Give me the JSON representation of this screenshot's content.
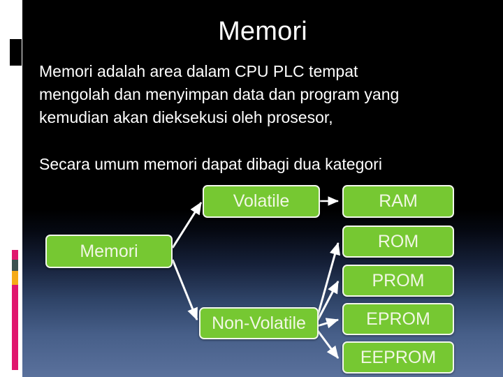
{
  "slide": {
    "title": "Memori",
    "paragraphs": [
      {
        "id": "intro",
        "line1": "Memori  adalah  area  dalam  CPU  PLC  tempat",
        "line2": "mengolah dan menyimpan data dan program yang",
        "line3": "kemudian akan dieksekusi oleh prosesor,"
      },
      {
        "id": "kategori",
        "text": "Secara umum memori dapat dibagi dua kategori"
      }
    ]
  },
  "diagram": {
    "type": "tree",
    "root": {
      "label": "Memori"
    },
    "branches": [
      {
        "label": "Volatile",
        "children": [
          {
            "label": "RAM"
          }
        ]
      },
      {
        "label": "Non-Volatile",
        "children": [
          {
            "label": "ROM"
          },
          {
            "label": "PROM"
          },
          {
            "label": "EPROM"
          },
          {
            "label": "EEPROM"
          }
        ]
      }
    ],
    "nodes": {
      "memori": "Memori",
      "volatile": "Volatile",
      "non_volatile": "Non-Volatile",
      "ram": "RAM",
      "rom": "ROM",
      "prom": "PROM",
      "eprom": "EPROM",
      "eeprom": "EEPROM"
    }
  },
  "theme": {
    "node_fill": "#76c832",
    "node_border": "#f2f7ec",
    "node_text": "#f1f7e4",
    "background_top": "#000000",
    "background_bottom": "#5a719c",
    "accent_pink": "#e0166e",
    "accent_orange": "#f5ab16",
    "accent_teal": "#3d5150",
    "text_color": "#ffffff"
  }
}
